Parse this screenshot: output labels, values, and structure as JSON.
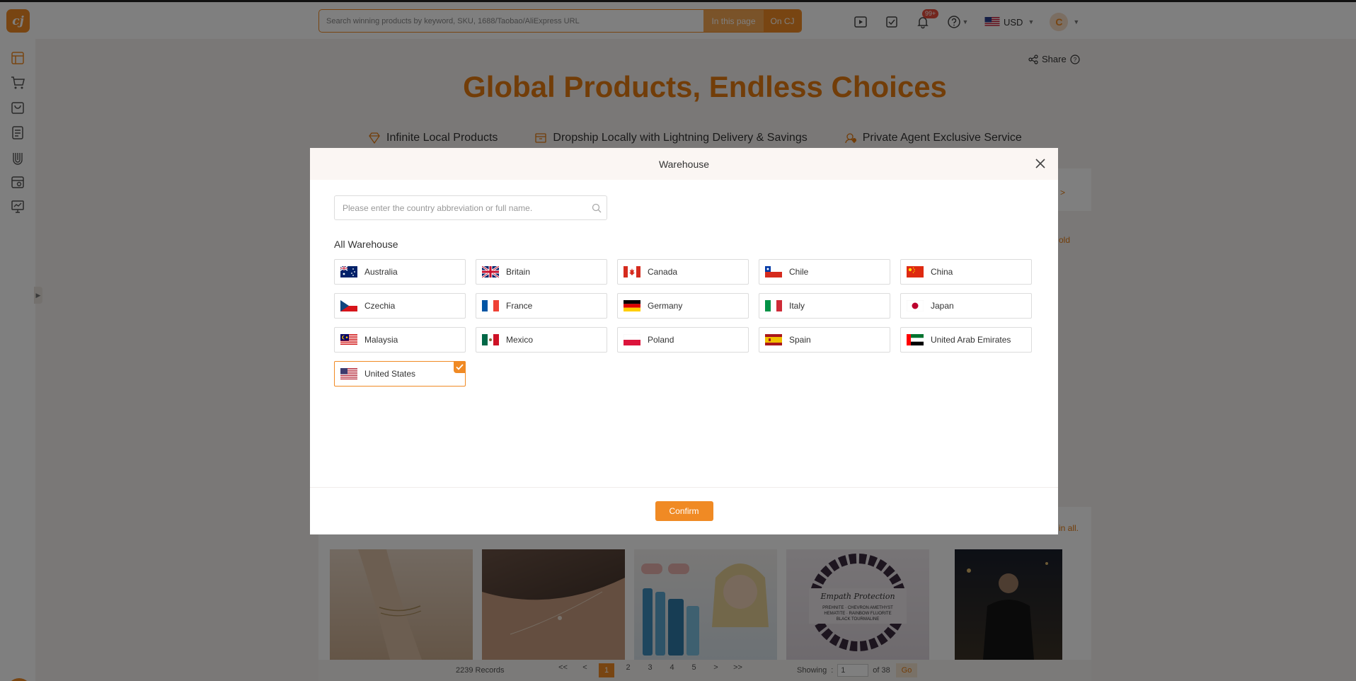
{
  "header": {
    "logo_text": "cj",
    "search_placeholder": "Search winning products by keyword, SKU, 1688/Taobao/AliExpress URL",
    "btn_in_page": "In this page",
    "btn_on_cj": "On CJ",
    "notification_badge": "99+",
    "currency": "USD",
    "avatar_letter": "C"
  },
  "background": {
    "share_label": "Share",
    "hero_title": "Global Products, Endless Choices",
    "features": [
      "Infinite Local Products",
      "Dropship Locally with Lightning Delivery & Savings",
      "Private Agent Exclusive Service"
    ],
    "edge_fragments": [
      "e >",
      "old",
      "in all."
    ],
    "pagination": {
      "records": "2239 Records",
      "pages": [
        "<<",
        "<",
        "1",
        "2",
        "3",
        "4",
        "5",
        ">",
        ">>"
      ],
      "active_page": "1",
      "showing_label": "Showing",
      "showing_value": "1",
      "of_label": "of 38",
      "go_label": "Go"
    }
  },
  "modal": {
    "title": "Warehouse",
    "search_placeholder": "Please enter the country abbreviation or full name.",
    "section_label": "All Warehouse",
    "warehouses": [
      {
        "name": "Australia",
        "flag": "au",
        "selected": false
      },
      {
        "name": "Britain",
        "flag": "gb",
        "selected": false
      },
      {
        "name": "Canada",
        "flag": "ca",
        "selected": false
      },
      {
        "name": "Chile",
        "flag": "cl",
        "selected": false
      },
      {
        "name": "China",
        "flag": "cn",
        "selected": false
      },
      {
        "name": "Czechia",
        "flag": "cz",
        "selected": false
      },
      {
        "name": "France",
        "flag": "fr",
        "selected": false
      },
      {
        "name": "Germany",
        "flag": "de",
        "selected": false
      },
      {
        "name": "Italy",
        "flag": "it",
        "selected": false
      },
      {
        "name": "Japan",
        "flag": "jp",
        "selected": false
      },
      {
        "name": "Malaysia",
        "flag": "my",
        "selected": false
      },
      {
        "name": "Mexico",
        "flag": "mx",
        "selected": false
      },
      {
        "name": "Poland",
        "flag": "pl",
        "selected": false
      },
      {
        "name": "Spain",
        "flag": "es",
        "selected": false
      },
      {
        "name": "United Arab Emirates",
        "flag": "ae",
        "selected": false
      },
      {
        "name": "United States",
        "flag": "us",
        "selected": true
      }
    ],
    "confirm_label": "Confirm"
  },
  "colors": {
    "accent": "#f08a24",
    "accent_light": "#f4a653",
    "hero": "#e57a10"
  }
}
